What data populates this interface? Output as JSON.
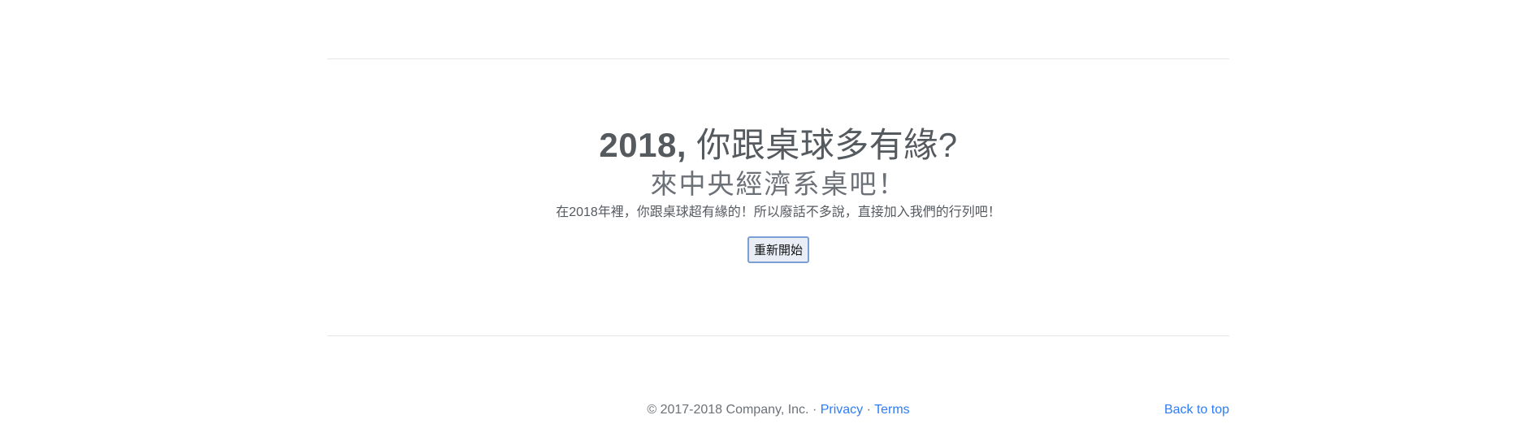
{
  "hero": {
    "headline_year": "2018,",
    "headline_rest": " 你跟桌球多有緣?",
    "subheadline": "來中央經濟系桌吧！",
    "lead": "在2018年裡，你跟桌球超有緣的！所以廢話不多說，直接加入我們的行列吧！",
    "restart_label": "重新開始"
  },
  "footer": {
    "copyright": "© 2017-2018 Company, Inc. · ",
    "privacy_label": "Privacy",
    "separator": " · ",
    "terms_label": "Terms",
    "back_to_top_label": "Back to top"
  },
  "colors": {
    "link": "#2e7cf6",
    "text": "#555a5f",
    "divider": "#e5e5e5",
    "button_border": "#7b9fd3"
  }
}
